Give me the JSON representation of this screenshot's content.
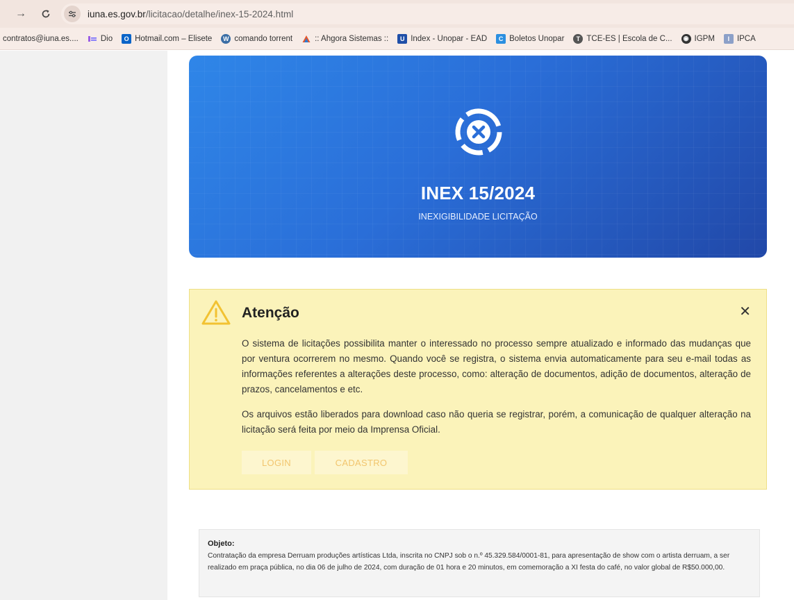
{
  "browser": {
    "url_host": "iuna.es.gov.br",
    "url_path": "/licitacao/detalhe/inex-15-2024.html",
    "bookmarks": [
      {
        "label": "contratos@iuna.es....",
        "icon": "mail-icon"
      },
      {
        "label": "Dio",
        "icon": "dio-icon"
      },
      {
        "label": "Hotmail.com – Elisete",
        "icon": "outlook-icon"
      },
      {
        "label": "comando torrent",
        "icon": "wordpress-icon"
      },
      {
        "label": ":: Ahgora Sistemas ::",
        "icon": "ahgora-icon"
      },
      {
        "label": "Index - Unopar - EAD",
        "icon": "unopar-icon"
      },
      {
        "label": "Boletos Unopar",
        "icon": "boletos-icon"
      },
      {
        "label": "TCE-ES | Escola de C...",
        "icon": "tce-icon"
      },
      {
        "label": "IGPM",
        "icon": "globe-icon"
      },
      {
        "label": "IPCA",
        "icon": "ipca-icon"
      }
    ]
  },
  "hero": {
    "title": "INEX 15/2024",
    "subtitle": "INEXIGIBILIDADE LICITAÇÃO"
  },
  "alert": {
    "title": "Atenção",
    "close": "✕",
    "paragraph1": "O sistema de licitações possibilita manter o interessado no processo sempre atualizado e informado das mudanças que por ventura ocorrerem no mesmo. Quando você se registra, o sistema envia automaticamente para seu e-mail todas as informações referentes a alterações deste processo, como: alteração de documentos, adição de documentos, alteração de prazos, cancelamentos e etc.",
    "paragraph2": "Os arquivos estão liberados para download caso não queria se registrar, porém, a comunicação de qualquer alteração na licitação será feita por meio da Imprensa Oficial.",
    "login_label": "LOGIN",
    "cadastro_label": "CADASTRO"
  },
  "objeto": {
    "label": "Objeto:",
    "text": "Contratação da empresa Derruam produções artísticas Ltda, inscrita no CNPJ sob o n.º 45.329.584/0001-81, para apresentação de show com o artista derruam, a ser realizado em praça pública, no dia 06 de julho de 2024, com duração de 01 hora e 20 minutos, em comemoração a XI festa do café, no valor global de R$50.000,00."
  },
  "colors": {
    "hero_blue": "#2a6ed8",
    "alert_bg": "#fbf3ba",
    "button_text": "#f2c56e"
  }
}
